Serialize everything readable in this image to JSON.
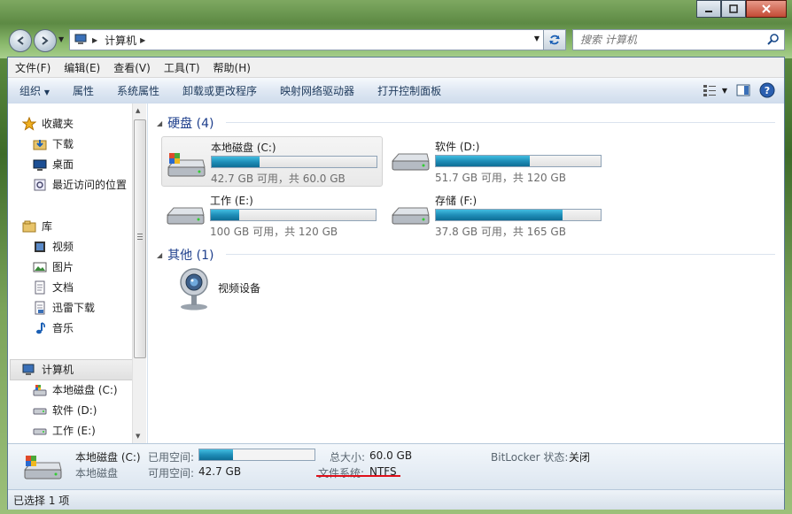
{
  "window": {
    "address": {
      "crumb": "计算机"
    },
    "search": {
      "placeholder": "搜索 计算机"
    }
  },
  "menu": [
    "文件(F)",
    "编辑(E)",
    "查看(V)",
    "工具(T)",
    "帮助(H)"
  ],
  "toolbar": [
    "组织",
    "属性",
    "系统属性",
    "卸载或更改程序",
    "映射网络驱动器",
    "打开控制面板"
  ],
  "nav": {
    "favorites": {
      "label": "收藏夹",
      "items": [
        "下载",
        "桌面",
        "最近访问的位置"
      ]
    },
    "libraries": {
      "label": "库",
      "items": [
        "视频",
        "图片",
        "文档",
        "迅雷下载",
        "音乐"
      ]
    },
    "computer": {
      "label": "计算机",
      "items": [
        "本地磁盘 (C:)",
        "软件 (D:)",
        "工作 (E:)"
      ]
    }
  },
  "groups": {
    "hdd": {
      "label": "硬盘 (4)"
    },
    "other": {
      "label": "其他 (1)"
    }
  },
  "drives": [
    {
      "name": "本地磁盘 (C:)",
      "info": "42.7 GB 可用，共 60.0 GB",
      "used_fraction": 0.29,
      "selected": true
    },
    {
      "name": "软件 (D:)",
      "info": "51.7 GB 可用，共 120 GB",
      "used_fraction": 0.57,
      "selected": false
    },
    {
      "name": "工作 (E:)",
      "info": "100 GB 可用，共 120 GB",
      "used_fraction": 0.17,
      "selected": false
    },
    {
      "name": "存储 (F:)",
      "info": "37.8 GB 可用，共 165 GB",
      "used_fraction": 0.77,
      "selected": false
    }
  ],
  "other_devices": [
    {
      "name": "视频设备"
    }
  ],
  "details": {
    "name": "本地磁盘 (C:)",
    "type": "本地磁盘",
    "used_label": "已用空间:",
    "used_fraction": 0.29,
    "free_label": "可用空间:",
    "free_value": "42.7 GB",
    "total_label": "总大小:",
    "total_value": "60.0 GB",
    "fs_label": "文件系统:",
    "fs_value": "NTFS",
    "bitlocker_label": "BitLocker 状态:",
    "bitlocker_value": "关闭"
  },
  "status": {
    "text": "已选择 1 项"
  },
  "colors": {
    "accent": "#1e3f8c",
    "bar_fill": "#1f8eb8",
    "annotation": "#e0101a"
  }
}
